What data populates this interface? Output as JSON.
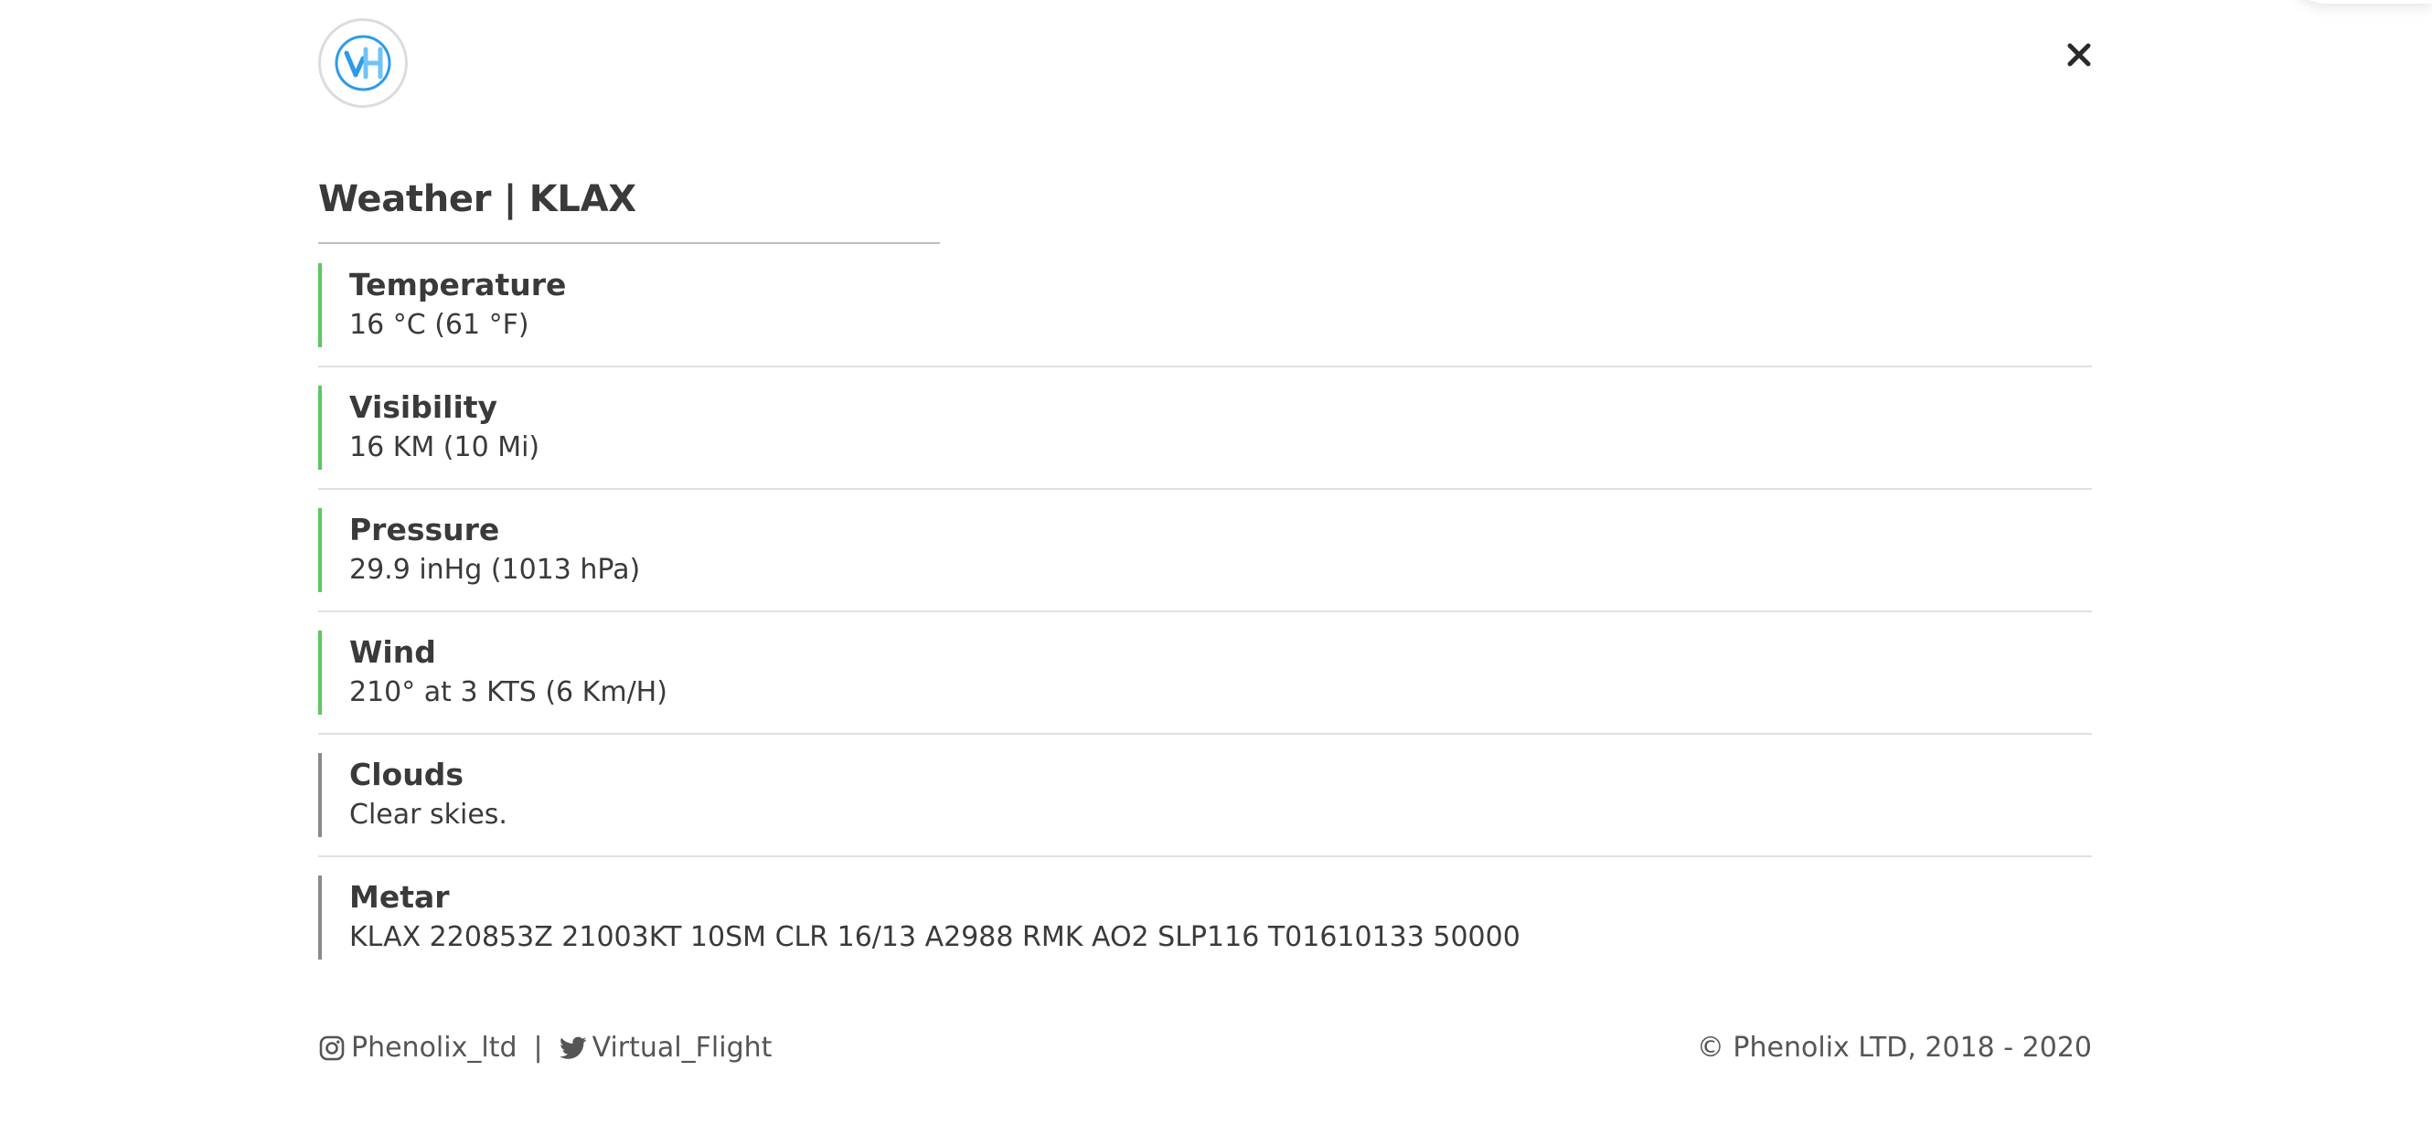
{
  "header": {
    "logo_text": "VH",
    "close_icon": "close-icon"
  },
  "page": {
    "title": "Weather | KLAX"
  },
  "colors": {
    "accent_green": "#5cc85c",
    "accent_gray": "#8a8a8a",
    "logo_blue": "#2e9be8"
  },
  "weather": {
    "rows": [
      {
        "label": "Temperature",
        "value": "16 °C (61 °F)",
        "status": "green"
      },
      {
        "label": "Visibility",
        "value": "16 KM (10 Mi)",
        "status": "green"
      },
      {
        "label": "Pressure",
        "value": "29.9 inHg (1013 hPa)",
        "status": "green"
      },
      {
        "label": "Wind",
        "value": "210° at 3 KTS (6 Km/H)",
        "status": "green"
      },
      {
        "label": "Clouds",
        "value": "Clear skies.",
        "status": "gray"
      },
      {
        "label": "Metar",
        "value": "KLAX 220853Z 21003KT 10SM CLR 16/13 A2988 RMK AO2 SLP116 T01610133 50000",
        "status": "gray"
      }
    ]
  },
  "footer": {
    "instagram_icon": "instagram-icon",
    "instagram": "Phenolix_ltd",
    "separator": "|",
    "twitter_icon": "twitter-icon",
    "twitter": "Virtual_Flight",
    "copyright": "© Phenolix LTD, 2018 - 2020"
  }
}
